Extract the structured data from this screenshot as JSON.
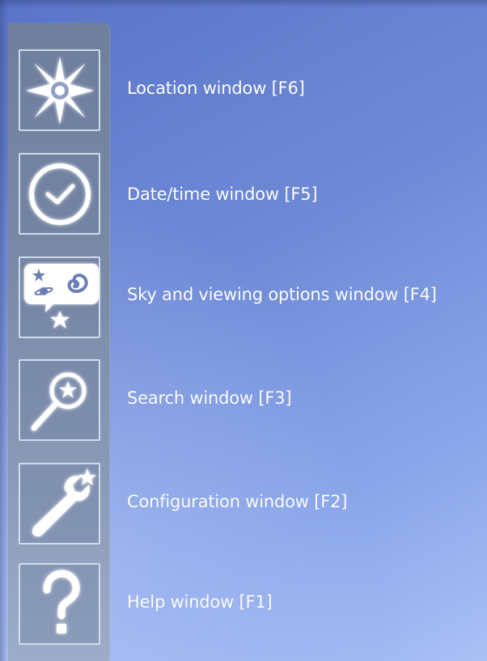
{
  "menu": {
    "items": [
      {
        "id": "location",
        "label": "Location window  [F6]",
        "icon": "location-icon"
      },
      {
        "id": "datetime",
        "label": "Date/time window  [F5]",
        "icon": "clock-icon"
      },
      {
        "id": "sky",
        "label": "Sky and viewing options window  [F4]",
        "icon": "sky-options-icon"
      },
      {
        "id": "search",
        "label": "Search window  [F3]",
        "icon": "search-icon"
      },
      {
        "id": "configuration",
        "label": "Configuration window  [F2]",
        "icon": "wrench-icon"
      },
      {
        "id": "help",
        "label": "Help window  [F1]",
        "icon": "help-icon"
      }
    ]
  },
  "colors": {
    "panel_top": "#5a75c8",
    "panel_bottom": "#a9c1f5",
    "sidebar": "#7888a5",
    "label": "#ffffff"
  }
}
